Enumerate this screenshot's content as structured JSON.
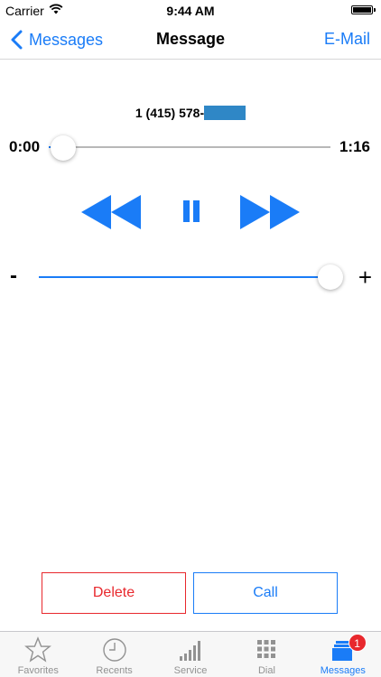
{
  "status_bar": {
    "carrier": "Carrier",
    "time": "9:44 AM"
  },
  "nav": {
    "back_label": "Messages",
    "title": "Message",
    "email_label": "E-Mail"
  },
  "message": {
    "caller_prefix": "1 (415) 578-",
    "elapsed": "0:00",
    "duration": "1:16",
    "progress": 0.01,
    "volume": 0.99
  },
  "volume": {
    "minus_label": "-",
    "plus_label": "+"
  },
  "actions": {
    "delete_label": "Delete",
    "call_label": "Call"
  },
  "tab_bar": {
    "tabs": [
      {
        "label": "Favorites",
        "icon": "star-icon"
      },
      {
        "label": "Recents",
        "icon": "clock-icon"
      },
      {
        "label": "Service",
        "icon": "signal-bars-icon"
      },
      {
        "label": "Dial",
        "icon": "keypad-icon"
      },
      {
        "label": "Messages",
        "icon": "messages-icon",
        "badge": "1",
        "active": true
      }
    ]
  },
  "colors": {
    "accent": "#1a7cf7",
    "destructive": "#e8282d",
    "inactive": "#929292"
  }
}
